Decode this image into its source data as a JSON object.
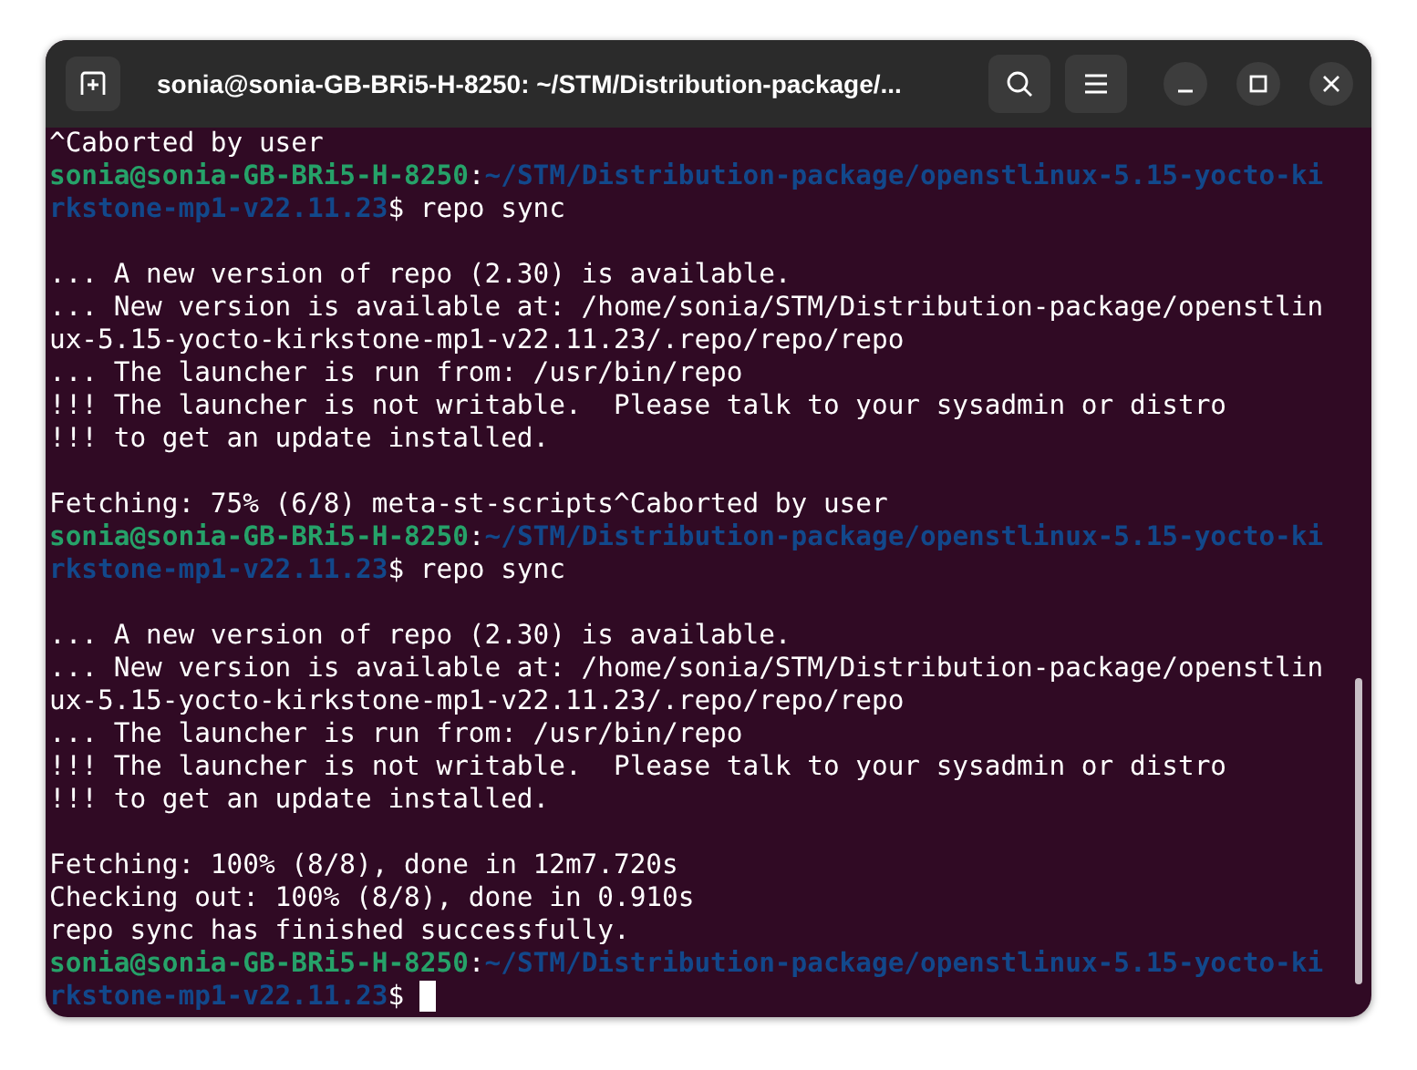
{
  "window": {
    "title": "sonia@sonia-GB-BRi5-H-8250: ~/STM/Distribution-package/..."
  },
  "terminal": {
    "blocks": [
      {
        "lines": [
          {
            "segments": [
              {
                "kind": "plain",
                "text": "^Caborted by user"
              }
            ]
          },
          {
            "segments": [
              {
                "kind": "host",
                "text": "sonia@sonia-GB-BRi5-H-8250"
              },
              {
                "kind": "plain",
                "text": ":"
              },
              {
                "kind": "path",
                "text": "~/STM/Distribution-package/openstlinux-5.15-yocto-ki"
              }
            ]
          },
          {
            "segments": [
              {
                "kind": "path",
                "text": "rkstone-mp1-v22.11.23"
              },
              {
                "kind": "plain",
                "text": "$ repo sync"
              }
            ]
          }
        ]
      },
      {
        "lines": [
          {
            "segments": [
              {
                "kind": "plain",
                "text": "... A new version of repo (2.30) is available."
              }
            ]
          },
          {
            "segments": [
              {
                "kind": "plain",
                "text": "... New version is available at: /home/sonia/STM/Distribution-package/openstlin"
              }
            ]
          },
          {
            "segments": [
              {
                "kind": "plain",
                "text": "ux-5.15-yocto-kirkstone-mp1-v22.11.23/.repo/repo/repo"
              }
            ]
          },
          {
            "segments": [
              {
                "kind": "plain",
                "text": "... The launcher is run from: /usr/bin/repo"
              }
            ]
          },
          {
            "segments": [
              {
                "kind": "plain",
                "text": "!!! The launcher is not writable.  Please talk to your sysadmin or distro"
              }
            ]
          },
          {
            "segments": [
              {
                "kind": "plain",
                "text": "!!! to get an update installed."
              }
            ]
          }
        ]
      },
      {
        "lines": [
          {
            "segments": [
              {
                "kind": "plain",
                "text": "Fetching: 75% (6/8) meta-st-scripts^Caborted by user"
              }
            ]
          },
          {
            "segments": [
              {
                "kind": "host",
                "text": "sonia@sonia-GB-BRi5-H-8250"
              },
              {
                "kind": "plain",
                "text": ":"
              },
              {
                "kind": "path",
                "text": "~/STM/Distribution-package/openstlinux-5.15-yocto-ki"
              }
            ]
          },
          {
            "segments": [
              {
                "kind": "path",
                "text": "rkstone-mp1-v22.11.23"
              },
              {
                "kind": "plain",
                "text": "$ repo sync"
              }
            ]
          }
        ]
      },
      {
        "lines": [
          {
            "segments": [
              {
                "kind": "plain",
                "text": "... A new version of repo (2.30) is available."
              }
            ]
          },
          {
            "segments": [
              {
                "kind": "plain",
                "text": "... New version is available at: /home/sonia/STM/Distribution-package/openstlin"
              }
            ]
          },
          {
            "segments": [
              {
                "kind": "plain",
                "text": "ux-5.15-yocto-kirkstone-mp1-v22.11.23/.repo/repo/repo"
              }
            ]
          },
          {
            "segments": [
              {
                "kind": "plain",
                "text": "... The launcher is run from: /usr/bin/repo"
              }
            ]
          },
          {
            "segments": [
              {
                "kind": "plain",
                "text": "!!! The launcher is not writable.  Please talk to your sysadmin or distro"
              }
            ]
          },
          {
            "segments": [
              {
                "kind": "plain",
                "text": "!!! to get an update installed."
              }
            ]
          }
        ]
      },
      {
        "lines": [
          {
            "segments": [
              {
                "kind": "plain",
                "text": "Fetching: 100% (8/8), done in 12m7.720s"
              }
            ]
          },
          {
            "segments": [
              {
                "kind": "plain",
                "text": "Checking out: 100% (8/8), done in 0.910s"
              }
            ]
          },
          {
            "segments": [
              {
                "kind": "plain",
                "text": "repo sync has finished successfully."
              }
            ]
          },
          {
            "segments": [
              {
                "kind": "host",
                "text": "sonia@sonia-GB-BRi5-H-8250"
              },
              {
                "kind": "plain",
                "text": ":"
              },
              {
                "kind": "path",
                "text": "~/STM/Distribution-package/openstlinux-5.15-yocto-ki"
              }
            ]
          },
          {
            "segments": [
              {
                "kind": "path",
                "text": "rkstone-mp1-v22.11.23"
              },
              {
                "kind": "plain",
                "text": "$ "
              }
            ],
            "cursor": true
          }
        ]
      }
    ]
  }
}
